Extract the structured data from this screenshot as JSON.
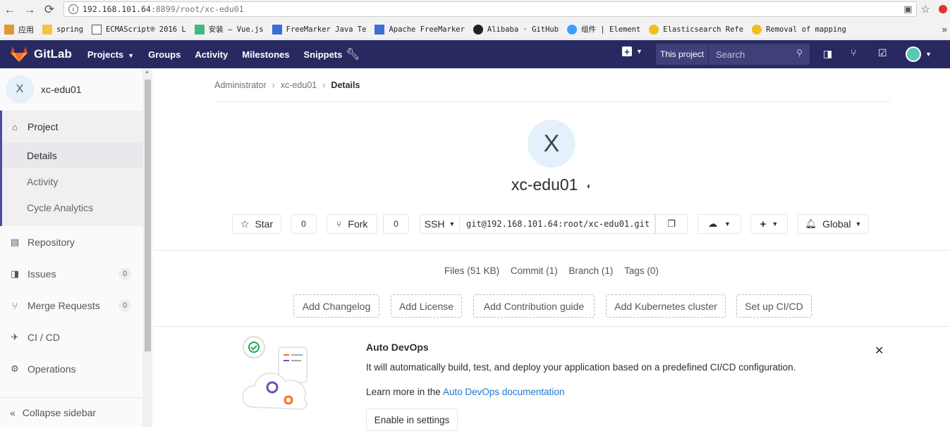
{
  "browser": {
    "url_host": "192.168.101.64",
    "url_port": ":8899",
    "url_path": "/root/xc-edu01",
    "bookmarks": [
      {
        "label": "应用",
        "icon": "apps-icon"
      },
      {
        "label": "spring",
        "icon": "folder-icon"
      },
      {
        "label": "ECMAScript® 2016 L",
        "icon": "page-icon"
      },
      {
        "label": "安装 — Vue.js",
        "icon": "vue-icon"
      },
      {
        "label": "FreeMarker Java Te",
        "icon": "code-icon"
      },
      {
        "label": "Apache FreeMarker",
        "icon": "code-icon"
      },
      {
        "label": "Alibaba · GitHub",
        "icon": "github-icon"
      },
      {
        "label": "组件 | Element",
        "icon": "element-icon"
      },
      {
        "label": "Elasticsearch Refe",
        "icon": "elastic-icon"
      },
      {
        "label": "Removal of mapping",
        "icon": "elastic-icon"
      }
    ],
    "more_bookmarks": "»"
  },
  "topnav": {
    "brand": "GitLab",
    "items": [
      "Projects",
      "Groups",
      "Activity",
      "Milestones",
      "Snippets"
    ],
    "this_project": "This project",
    "search_placeholder": "Search"
  },
  "sidebar": {
    "project_avatar": "X",
    "project_name": "xc-edu01",
    "project_label": "Project",
    "sub_items": [
      "Details",
      "Activity",
      "Cycle Analytics"
    ],
    "items": [
      {
        "label": "Repository",
        "icon": "repository-icon"
      },
      {
        "label": "Issues",
        "icon": "issues-icon",
        "count": "0"
      },
      {
        "label": "Merge Requests",
        "icon": "merge-request-icon",
        "count": "0"
      },
      {
        "label": "CI / CD",
        "icon": "rocket-icon"
      },
      {
        "label": "Operations",
        "icon": "gear-icon"
      }
    ],
    "collapse_label": "Collapse sidebar"
  },
  "main": {
    "breadcrumb": [
      "Administrator",
      "xc-edu01",
      "Details"
    ],
    "avatar_letter": "X",
    "title": "xc-edu01",
    "star_label": "Star",
    "star_count": "0",
    "fork_label": "Fork",
    "fork_count": "0",
    "protocol": "SSH",
    "clone_url": "git@192.168.101.64:root/xc-edu01.git",
    "notification_label": "Global",
    "stats": [
      "Files (51 KB)",
      "Commit (1)",
      "Branch (1)",
      "Tags (0)"
    ],
    "actions": [
      "Add Changelog",
      "Add License",
      "Add Contribution guide",
      "Add Kubernetes cluster",
      "Set up CI/CD"
    ],
    "devops": {
      "title": "Auto DevOps",
      "description": "It will automatically build, test, and deploy your application based on a predefined CI/CD configuration.",
      "learn_prefix": "Learn more in the ",
      "learn_link": "Auto DevOps documentation",
      "enable_button": "Enable in settings"
    }
  }
}
